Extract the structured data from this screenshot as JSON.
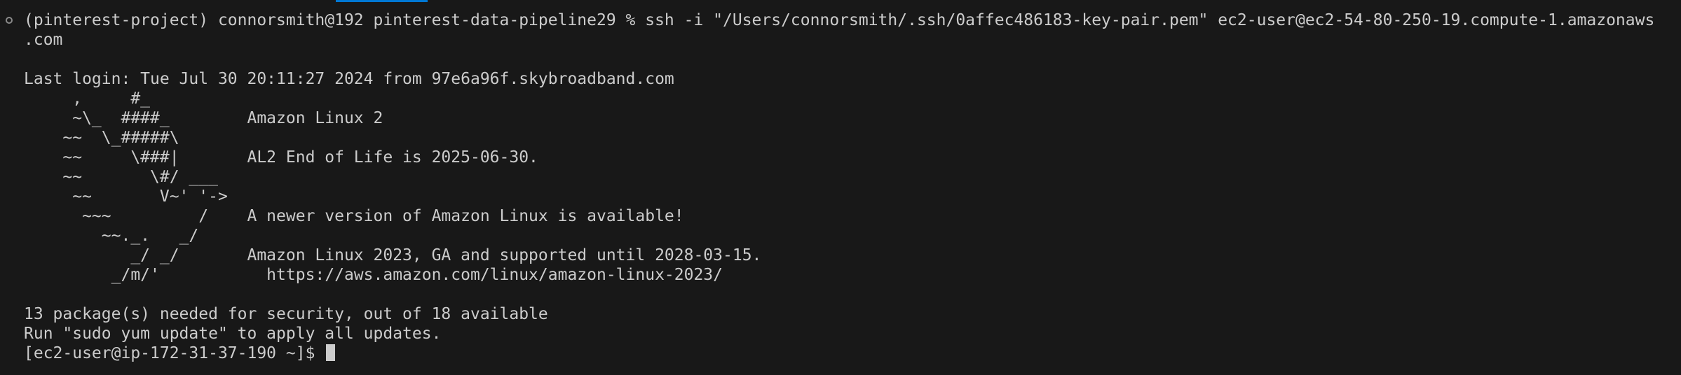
{
  "terminal": {
    "command_line_1": "(pinterest-project) connorsmith@192 pinterest-data-pipeline29 % ssh -i \"/Users/connorsmith/.ssh/0affec486183-key-pair.pem\" ec2-user@ec2-54-80-250-19.compute-1.amazonaws",
    "command_line_2": ".com",
    "blank_1": "",
    "last_login": "Last login: Tue Jul 30 20:11:27 2024 from 97e6a96f.skybroadband.com",
    "motd": [
      "     ,     #_",
      "     ~\\_  ####_        Amazon Linux 2",
      "    ~~  \\_#####\\",
      "    ~~     \\###|       AL2 End of Life is 2025-06-30.",
      "    ~~       \\#/ ___",
      "     ~~       V~' '->",
      "      ~~~         /    A newer version of Amazon Linux is available!",
      "        ~~._.   _/",
      "           _/ _/       Amazon Linux 2023, GA and supported until 2028-03-15.",
      "         _/m/'           https://aws.amazon.com/linux/amazon-linux-2023/"
    ],
    "blank_2": "",
    "security_notice": "13 package(s) needed for security, out of 18 available",
    "update_hint": "Run \"sudo yum update\" to apply all updates.",
    "prompt": "[ec2-user@ip-172-31-37-190 ~]$ "
  }
}
